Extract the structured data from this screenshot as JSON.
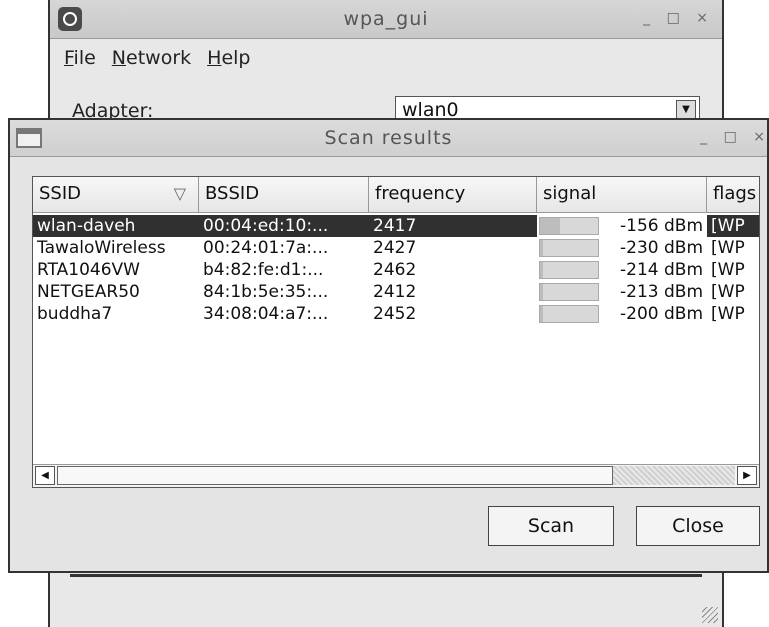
{
  "main_window": {
    "title": "wpa_gui",
    "window_buttons": "_ □ ×",
    "menu": [
      "File",
      "Network",
      "Help"
    ],
    "adapter_label": "Adapter:",
    "adapter_value": "wlan0"
  },
  "scan_window": {
    "title": "Scan results",
    "window_buttons": "_ □ ×",
    "columns": [
      "SSID",
      "BSSID",
      "frequency",
      "signal",
      "flags"
    ],
    "rows": [
      {
        "ssid": "wlan-daveh",
        "bssid": "00:04:ed:10:...",
        "frequency": "2417",
        "signal": "-156 dBm",
        "signal_level": 0.35,
        "flags": "[WP",
        "selected": true
      },
      {
        "ssid": "TawaloWireless",
        "bssid": "00:24:01:7a:...",
        "frequency": "2427",
        "signal": "-230 dBm",
        "signal_level": 0.05,
        "flags": "[WP",
        "selected": false
      },
      {
        "ssid": "RTA1046VW",
        "bssid": "b4:82:fe:d1:...",
        "frequency": "2462",
        "signal": "-214 dBm",
        "signal_level": 0.05,
        "flags": "[WP",
        "selected": false
      },
      {
        "ssid": "NETGEAR50",
        "bssid": "84:1b:5e:35:...",
        "frequency": "2412",
        "signal": "-213 dBm",
        "signal_level": 0.05,
        "flags": "[WP",
        "selected": false
      },
      {
        "ssid": "buddha7",
        "bssid": "34:08:04:a7:...",
        "frequency": "2452",
        "signal": "-200 dBm",
        "signal_level": 0.05,
        "flags": "[WP",
        "selected": false
      }
    ],
    "scan_button": "Scan",
    "close_button": "Close"
  }
}
